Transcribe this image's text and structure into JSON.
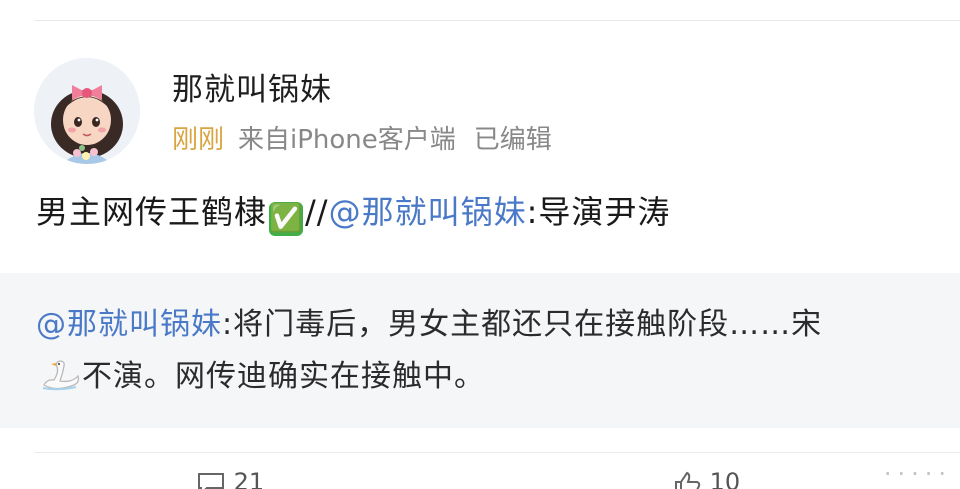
{
  "post": {
    "author": {
      "name": "那就叫锅妹"
    },
    "meta": {
      "time": "刚刚",
      "source": "来自iPhone客户端",
      "edited": "已编辑"
    },
    "text": {
      "part1": "男主网传王鹤棣",
      "emoji": "✅",
      "sep": "//",
      "mention": "@那就叫锅妹",
      "colon_text": ":导演尹涛"
    },
    "repost": {
      "mention": "@那就叫锅妹",
      "text_before": ":将门毒后，男女主都还只在接触阶段……宋",
      "text_after": "不演。网传迪确实在接触中。"
    },
    "actions": {
      "comment_count": "21",
      "like_count": "10"
    },
    "watermark": "·····"
  },
  "colors": {
    "mention": "#4a79c7",
    "time": "#d9a441",
    "repost_bg": "#f5f6f8"
  },
  "icons": {
    "comment": "comment-icon",
    "like": "like-icon",
    "check": "check-mark-emoji",
    "swan": "swan-emoji"
  }
}
